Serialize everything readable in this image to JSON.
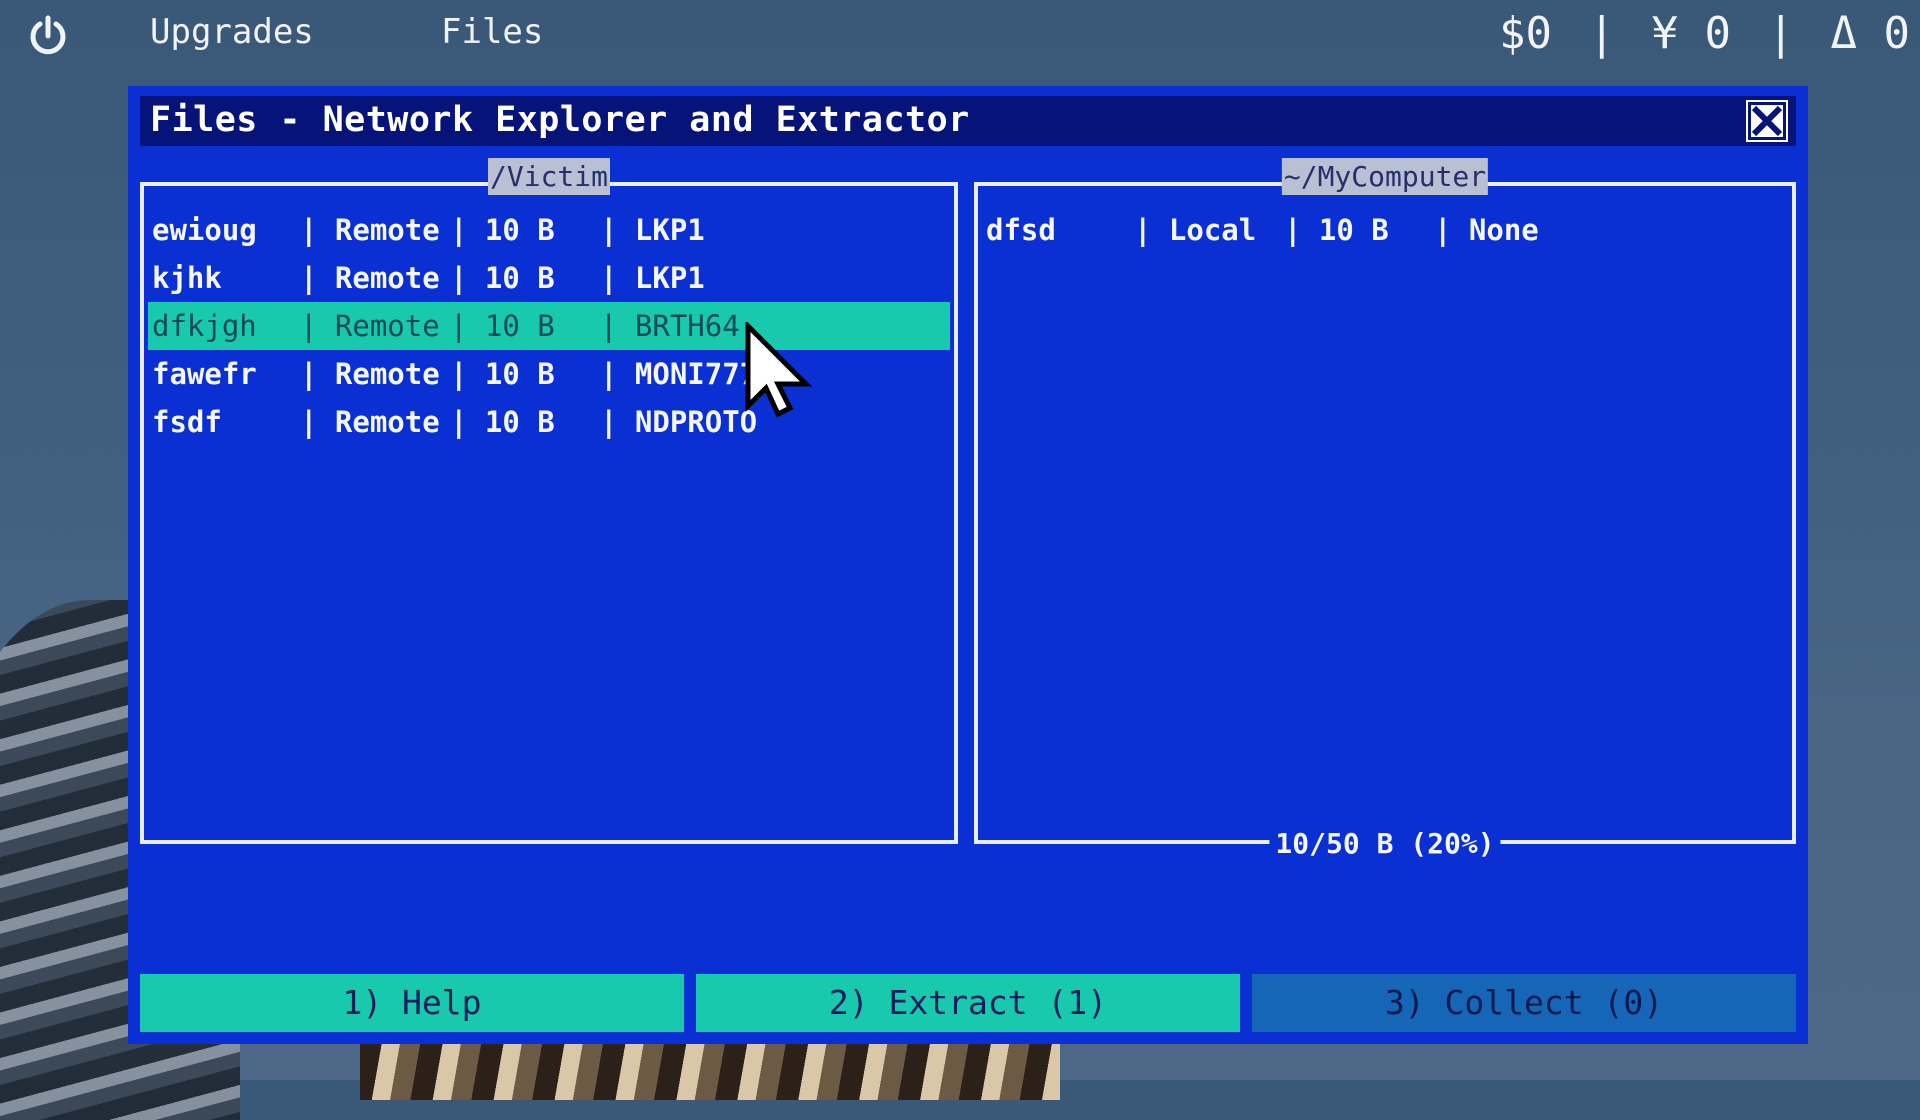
{
  "topbar": {
    "icon": "power-icon",
    "menu": [
      "Upgrades",
      "Files"
    ],
    "dollars": "$0",
    "yen": "¥ 0",
    "delta": "Δ 0",
    "separator": "|"
  },
  "window": {
    "title": "Files - Network Explorer and Extractor",
    "close_icon": "close-icon",
    "left_pane": {
      "label": "/Victim",
      "rows": [
        {
          "name": "ewioug",
          "location": "| Remote",
          "size": "| 10 B",
          "type": "| LKP1"
        },
        {
          "name": "kjhk",
          "location": "| Remote",
          "size": "| 10 B",
          "type": "| LKP1"
        },
        {
          "name": "dfkjgh",
          "location": "| Remote",
          "size": "| 10 B",
          "type": "| BRTH64"
        },
        {
          "name": "fawefr",
          "location": "| Remote",
          "size": "| 10 B",
          "type": "| MONI777"
        },
        {
          "name": "fsdf",
          "location": "| Remote",
          "size": "| 10 B",
          "type": "| NDPROTO"
        }
      ],
      "selected_index": 2
    },
    "right_pane": {
      "label": "~/MyComputer",
      "rows": [
        {
          "name": "dfsd",
          "location": "| Local",
          "size": "| 10 B",
          "type": "| None"
        }
      ],
      "capacity": "10/50 B (20%)"
    },
    "buttons": {
      "help": "1) Help",
      "extract": "2) Extract (1)",
      "collect": "3) Collect (0)"
    }
  },
  "colors": {
    "window_bg": "#0a2fd3",
    "titlebar_bg": "#06147a",
    "selection": "#19c9ad",
    "collect_button": "#1666b8"
  }
}
